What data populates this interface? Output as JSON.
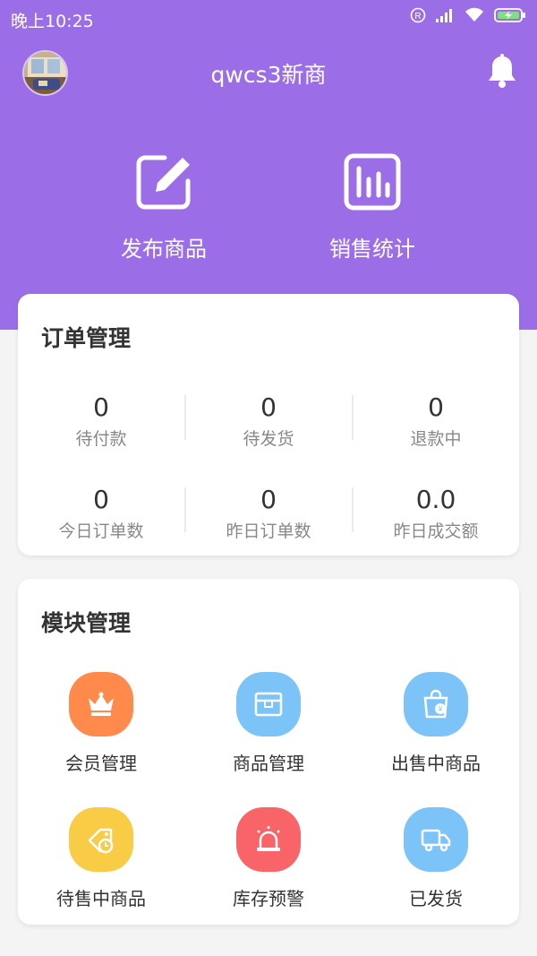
{
  "status_bar": {
    "time": "晚上10:25"
  },
  "header": {
    "shop_name": "qwcs3新商"
  },
  "actions": [
    {
      "label": "发布商品",
      "icon": "edit-icon"
    },
    {
      "label": "销售统计",
      "icon": "chart-icon"
    }
  ],
  "orders": {
    "title": "订单管理",
    "stats": [
      {
        "value": "0",
        "label": "待付款"
      },
      {
        "value": "0",
        "label": "待发货"
      },
      {
        "value": "0",
        "label": "退款中"
      },
      {
        "value": "0",
        "label": "今日订单数"
      },
      {
        "value": "0",
        "label": "昨日订单数"
      },
      {
        "value": "0.0",
        "label": "昨日成交额"
      }
    ]
  },
  "modules": {
    "title": "模块管理",
    "items": [
      {
        "label": "会员管理",
        "icon": "crown-icon",
        "color": "#ff8a4c"
      },
      {
        "label": "商品管理",
        "icon": "box-icon",
        "color": "#7cc4f8"
      },
      {
        "label": "出售中商品",
        "icon": "shopping-bag-icon",
        "color": "#7cc4f8"
      },
      {
        "label": "待售中商品",
        "icon": "tag-clock-icon",
        "color": "#f8cc45"
      },
      {
        "label": "库存预警",
        "icon": "alarm-icon",
        "color": "#f86468"
      },
      {
        "label": "已发货",
        "icon": "truck-icon",
        "color": "#7cc4f8"
      }
    ]
  },
  "colors": {
    "hero": "#9b6ee8",
    "background": "#f4f4f4"
  }
}
